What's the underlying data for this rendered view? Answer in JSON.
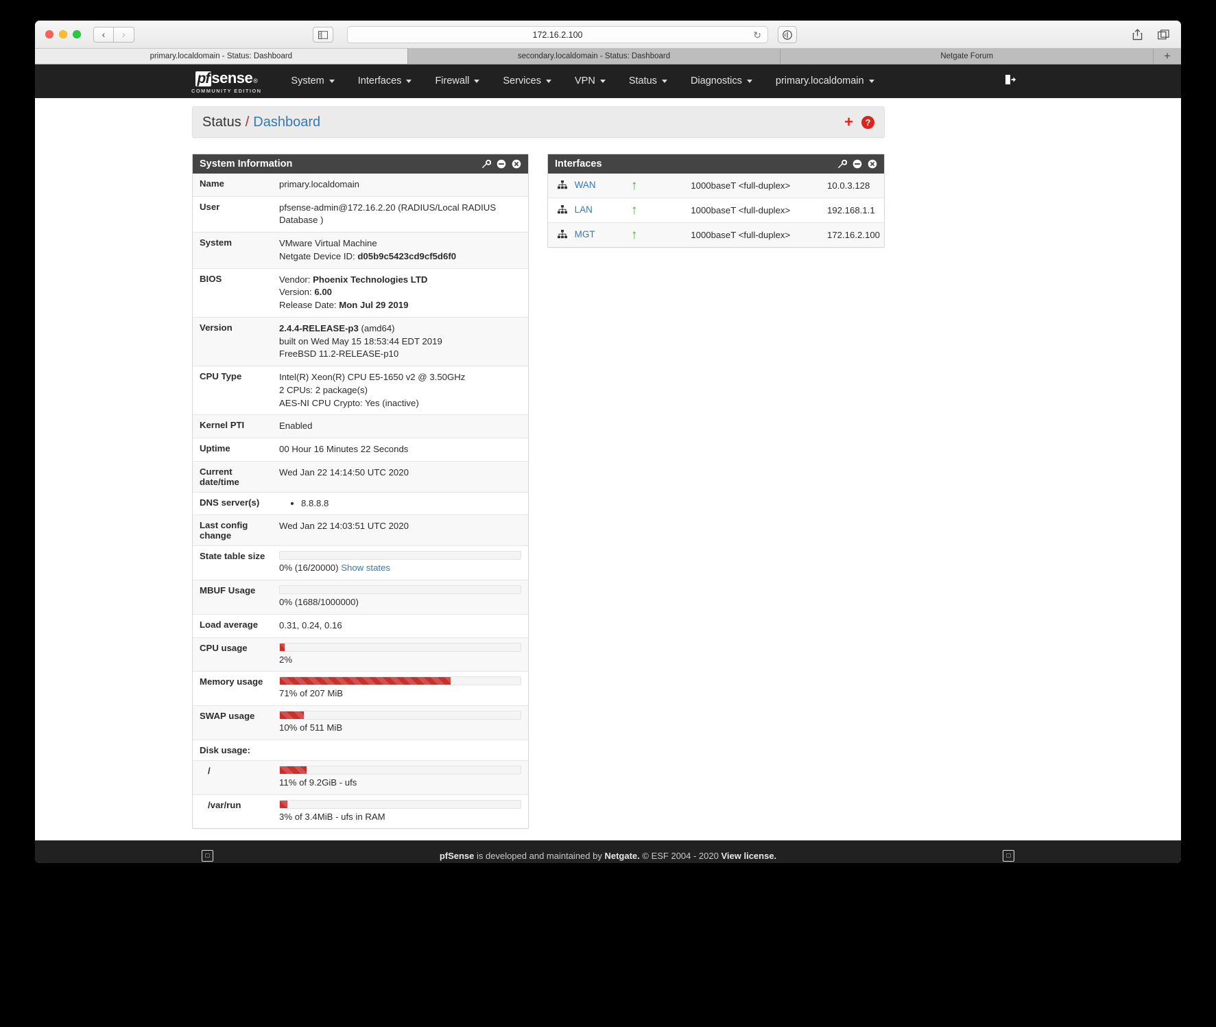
{
  "browser": {
    "url": "172.16.2.100",
    "reload_icon": "reload-icon",
    "tabs": [
      {
        "label": "primary.localdomain - Status: Dashboard",
        "active": true
      },
      {
        "label": "secondary.localdomain - Status: Dashboard",
        "active": false
      },
      {
        "label": "Netgate Forum",
        "active": false
      }
    ],
    "new_tab_label": "+"
  },
  "nav": {
    "logo_badge": "pf",
    "logo_word": "sense",
    "logo_reg": "®",
    "logo_sub": "COMMUNITY EDITION",
    "items": [
      {
        "label": "System"
      },
      {
        "label": "Interfaces"
      },
      {
        "label": "Firewall"
      },
      {
        "label": "Services"
      },
      {
        "label": "VPN"
      },
      {
        "label": "Status"
      },
      {
        "label": "Diagnostics"
      },
      {
        "label": "primary.localdomain"
      }
    ]
  },
  "breadcrumb": {
    "root": "Status",
    "separator": "/",
    "current": "Dashboard",
    "add_label": "+",
    "help_label": "?"
  },
  "system_widget": {
    "title": "System Information",
    "rows": {
      "name_label": "Name",
      "name_value": "primary.localdomain",
      "user_label": "User",
      "user_value": "pfsense-admin@172.16.2.20 (RADIUS/Local RADIUS Database )",
      "system_label": "System",
      "system_value": "VMware Virtual Machine",
      "device_id_label": "Netgate Device ID:",
      "device_id_value": "d05b9c5423cd9cf5d6f0",
      "bios_label": "BIOS",
      "bios_vendor_label": "Vendor:",
      "bios_vendor_value": "Phoenix Technologies LTD",
      "bios_version_label": "Version:",
      "bios_version_value": "6.00",
      "bios_release_label": "Release Date:",
      "bios_release_value": "Mon Jul 29 2019",
      "version_label": "Version",
      "version_value": "2.4.4-RELEASE-p3",
      "version_arch": "(amd64)",
      "version_built": "built on Wed May 15 18:53:44 EDT 2019",
      "version_base": "FreeBSD 11.2-RELEASE-p10",
      "cpu_label": "CPU Type",
      "cpu_value": "Intel(R) Xeon(R) CPU E5-1650 v2 @ 3.50GHz",
      "cpu_count": "2 CPUs: 2 package(s)",
      "cpu_crypto": "AES-NI CPU Crypto: Yes (inactive)",
      "kernel_pti_label": "Kernel PTI",
      "kernel_pti_value": "Enabled",
      "uptime_label": "Uptime",
      "uptime_value": "00 Hour 16 Minutes 22 Seconds",
      "datetime_label": "Current date/time",
      "datetime_value": "Wed Jan 22 14:14:50 UTC 2020",
      "dns_label": "DNS server(s)",
      "dns_value": "8.8.8.8",
      "lastconfig_label": "Last config change",
      "lastconfig_value": "Wed Jan 22 14:03:51 UTC 2020",
      "state_label": "State table size",
      "state_value": "0% (16/20000)",
      "state_link": "Show states",
      "state_percent": 0,
      "mbuf_label": "MBUF Usage",
      "mbuf_value": "0% (1688/1000000)",
      "mbuf_percent": 0,
      "load_label": "Load average",
      "load_value": "0.31, 0.24, 0.16",
      "cpu_usage_label": "CPU usage",
      "cpu_usage_value": "2%",
      "cpu_usage_percent": 2,
      "mem_label": "Memory usage",
      "mem_value": "71% of 207 MiB",
      "mem_percent": 71,
      "swap_label": "SWAP usage",
      "swap_value": "10% of 511 MiB",
      "swap_percent": 10,
      "disk_label": "Disk usage:",
      "disk_root_path": "/",
      "disk_root_value": "11% of 9.2GiB - ufs",
      "disk_root_percent": 11,
      "disk_varrun_path": "/var/run",
      "disk_varrun_value": "3% of 3.4MiB - ufs in RAM",
      "disk_varrun_percent": 3
    }
  },
  "interfaces_widget": {
    "title": "Interfaces",
    "rows": [
      {
        "name": "WAN",
        "status": "up",
        "media": "1000baseT <full-duplex>",
        "ip": "10.0.3.128"
      },
      {
        "name": "LAN",
        "status": "up",
        "media": "1000baseT <full-duplex>",
        "ip": "192.168.1.1"
      },
      {
        "name": "MGT",
        "status": "up",
        "media": "1000baseT <full-duplex>",
        "ip": "172.16.2.100"
      }
    ]
  },
  "footer": {
    "brand": "pfSense",
    "text_mid": " is developed and maintained by ",
    "netgate": "Netgate.",
    "copyright": " © ESF 2004 - 2020 ",
    "license": "View license."
  },
  "colors": {
    "navbar": "#212121",
    "widget_header": "#444444",
    "progress_red": "#c9302c",
    "link_blue": "#337ab7",
    "accent_red": "#d9261c",
    "arrow_green": "#4caf2f"
  }
}
